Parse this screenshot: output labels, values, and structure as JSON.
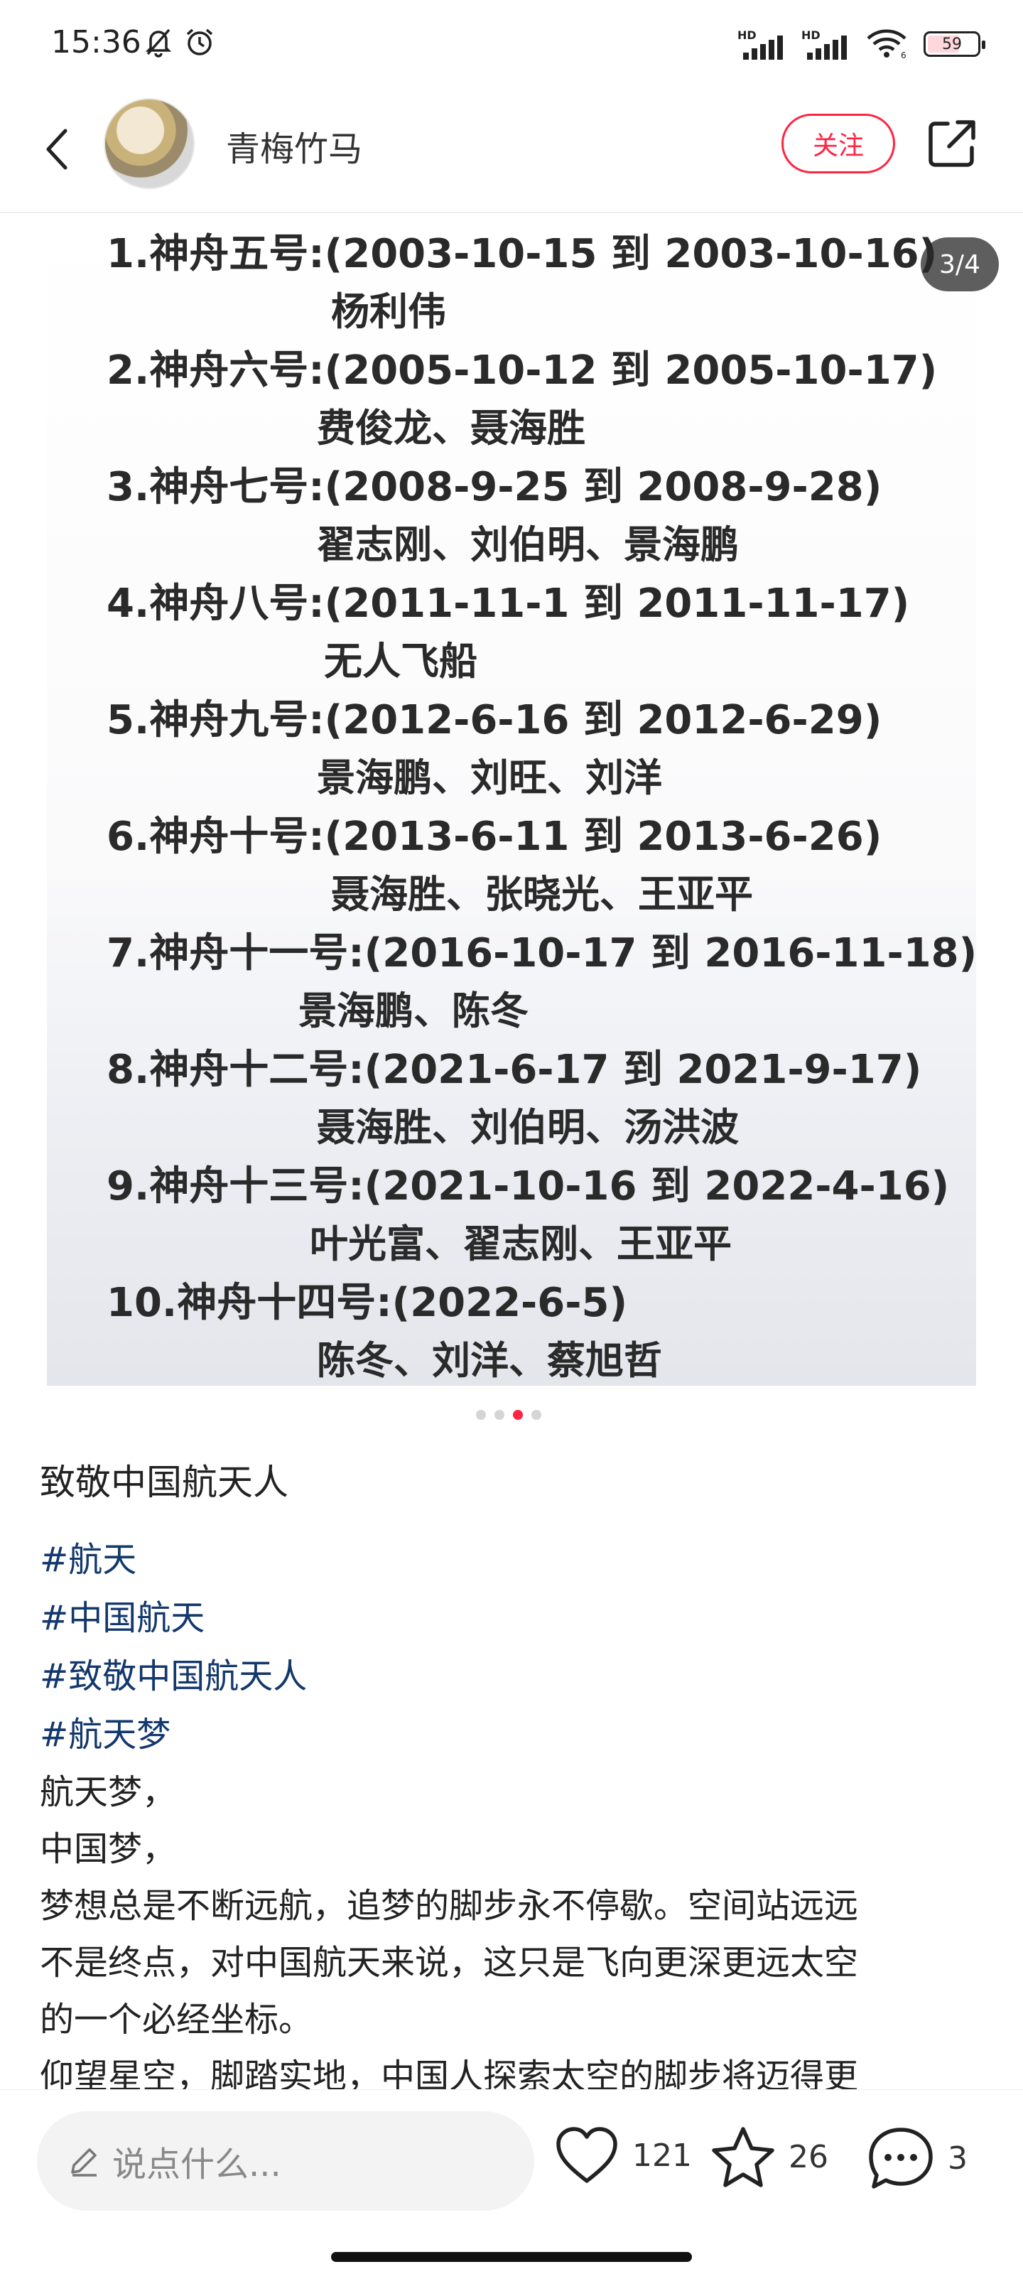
{
  "status_bar": {
    "time": "15:36",
    "battery": "59",
    "battery_level_percent": 59,
    "icons": [
      "mute-bell-icon",
      "alarm-icon",
      "signal-hd-icon",
      "signal-hd-icon",
      "wifi-icon",
      "battery-icon"
    ]
  },
  "header": {
    "author_name": "青梅竹马",
    "follow_label": "关注",
    "icons": [
      "back-arrow-icon",
      "share-icon"
    ]
  },
  "carousel": {
    "page_indicator": "3/4",
    "current_index": 3,
    "total": 4,
    "lines": [
      "1.神舟五号:(2003-10-15 到 2003-10-16)",
      "杨利伟",
      "2.神舟六号:(2005-10-12 到 2005-10-17)",
      "费俊龙、聂海胜",
      "3.神舟七号:(2008-9-25 到 2008-9-28)",
      "翟志刚、刘伯明、景海鹏",
      "4.神舟八号:(2011-11-1 到 2011-11-17)",
      "无人飞船",
      "5.神舟九号:(2012-6-16 到 2012-6-29)",
      "景海鹏、刘旺、刘洋",
      "6.神舟十号:(2013-6-11 到 2013-6-26)",
      "聂海胜、张晓光、王亚平",
      "7.神舟十一号:(2016-10-17 到 2016-11-18)",
      "景海鹏、陈冬",
      "8.神舟十二号:(2021-6-17 到 2021-9-17)",
      "聂海胜、刘伯明、汤洪波",
      "9.神舟十三号:(2021-10-16 到 2022-4-16)",
      "叶光富、翟志刚、王亚平",
      "10.神舟十四号:(2022-6-5)",
      "陈冬、刘洋、蔡旭哲"
    ]
  },
  "post": {
    "title": "致敬中国航天人",
    "tags": [
      "#航天",
      "#中国航天",
      "#致敬中国航天人",
      "#航天梦"
    ],
    "body": [
      "航天梦，",
      "中国梦，",
      "梦想总是不断远航，追梦的脚步永不停歇。空间站远远",
      "不是终点，对中国航天来说，这只是飞向更深更远太空",
      "的一个必经坐标。",
      "仰望星空，脚踏实地，中国人探索太空的脚步将迈得更"
    ]
  },
  "bottom_bar": {
    "comment_placeholder": "说点什么...",
    "likes": "121",
    "favorites": "26",
    "comments": "3",
    "icons": [
      "pencil-icon",
      "heart-icon",
      "star-icon",
      "comment-icon"
    ]
  },
  "colors": {
    "accent": "#ff2442",
    "tag": "#13386c",
    "text": "#222222"
  }
}
